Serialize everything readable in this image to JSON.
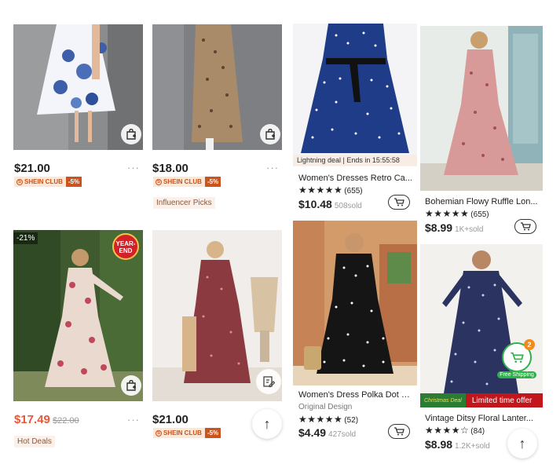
{
  "products": [
    {
      "id": "p1",
      "price": "$21.00",
      "club_label": "SHEIN CLUB",
      "club_discount": "-5%"
    },
    {
      "id": "p2",
      "price": "$18.00",
      "club_label": "SHEIN CLUB",
      "club_discount": "-5%",
      "tag": "Influencer Picks"
    },
    {
      "id": "p3",
      "banner": "Lightning deal | Ends in 15:55:58",
      "title": "Women's Dresses Retro Ca...",
      "stars": "★★★★★",
      "rating_count": "(655)",
      "price": "$10.48",
      "sold": "508sold"
    },
    {
      "id": "p4",
      "title": "Bohemian Flowy Ruffle Lon...",
      "stars": "★★★★★",
      "rating_count": "(655)",
      "price": "$8.99",
      "sold": "1K+sold"
    },
    {
      "id": "p5",
      "discount_badge": "-21%",
      "year_end_badge": "YEAR-END",
      "price": "$17.49",
      "original_price": "$22.00",
      "tag": "Hot Deals"
    },
    {
      "id": "p6",
      "price": "$21.00",
      "club_label": "SHEIN CLUB",
      "club_discount": "-5%"
    },
    {
      "id": "p7",
      "title": "Women's Dress Polka Dot V...",
      "subtitle": "Original Design",
      "stars": "★★★★★",
      "rating_count": "(52)",
      "price": "$4.49",
      "sold": "427sold"
    },
    {
      "id": "p8",
      "christmas_label": "Christmas Deal",
      "limited_label": "Limited time offer",
      "free_shipping_label": "Free Shipping",
      "cart_badge_count": "2",
      "title": "Vintage Ditsy Floral Lanter...",
      "stars": "★★★★☆",
      "rating_count": "(84)",
      "price": "$8.98",
      "sold": "1.2K+sold"
    }
  ],
  "more_options_label": "···",
  "colors": {
    "price_red": "#e8573a",
    "club_orange": "#c9541e",
    "free_shipping_green": "#2fb14a",
    "limited_red": "#c2161d"
  }
}
